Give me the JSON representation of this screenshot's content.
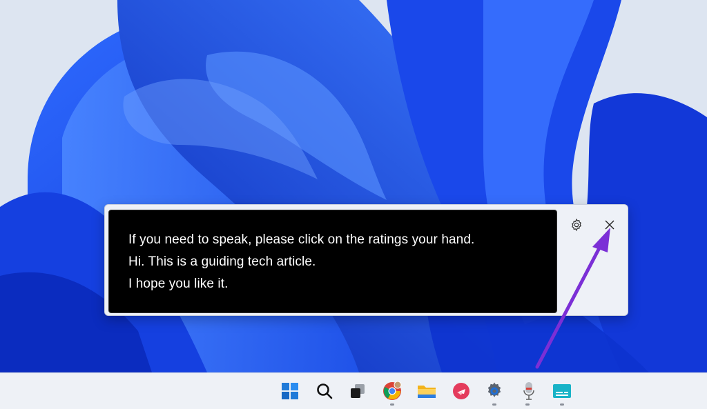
{
  "captions": {
    "line1": "If you need to speak, please click on the ratings your hand.",
    "line2": "Hi. This is a guiding tech article.",
    "line3": "I hope you like it."
  },
  "caption_window": {
    "settings_icon": "gear-icon",
    "close_icon": "close-icon"
  },
  "taskbar": {
    "icons": [
      "windows-start-icon",
      "search-icon",
      "task-view-icon",
      "chrome-icon",
      "file-explorer-icon",
      "pinned-app-icon",
      "settings-icon",
      "microphone-icon",
      "live-captions-icon"
    ]
  },
  "colors": {
    "annotation_arrow": "#7b2fd6",
    "caption_background": "#000000",
    "caption_text": "#ffffff"
  }
}
